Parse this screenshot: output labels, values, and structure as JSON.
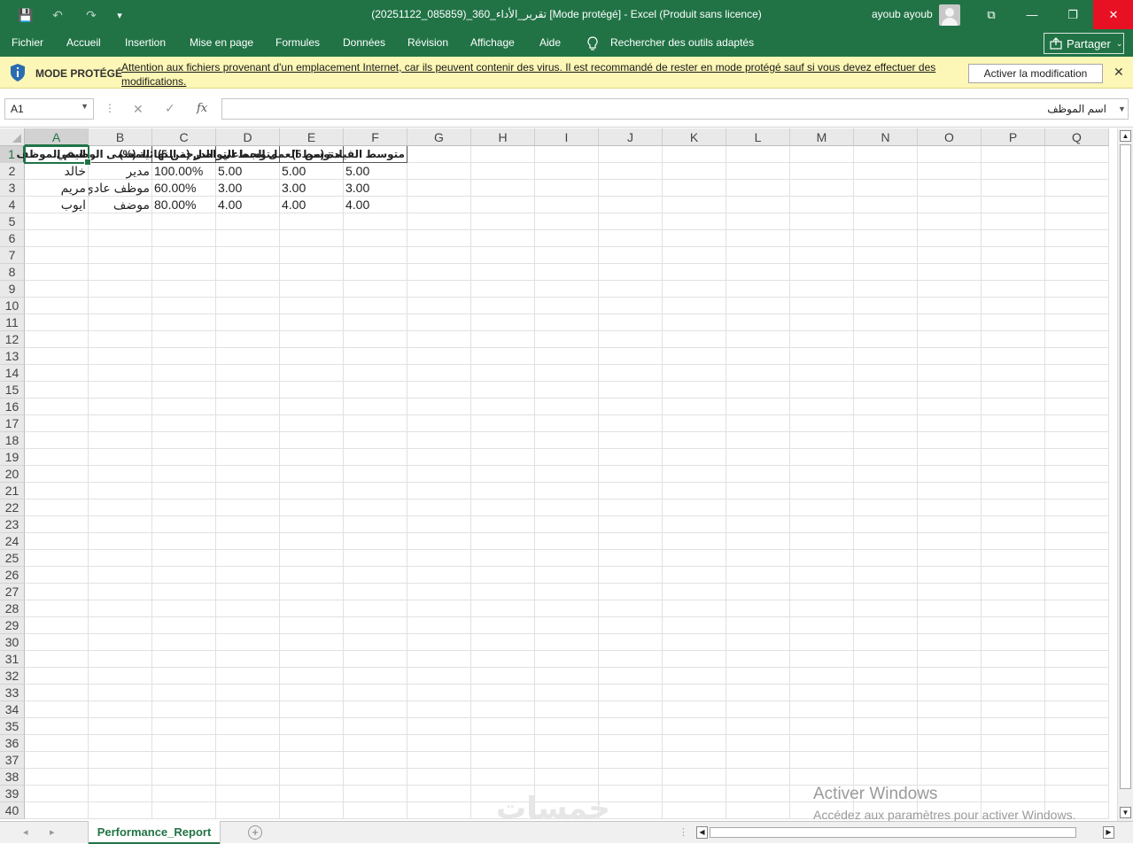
{
  "window": {
    "title": "تقرير_الأداء_360_(085859_20251122)  [Mode protégé]  -  Excel (Produit sans licence)",
    "user": "ayoub ayoub",
    "controls": {
      "ribbon_display": "⧉",
      "minimize": "—",
      "restore": "❐",
      "close": "✕"
    }
  },
  "quick_access": {
    "save": "💾",
    "undo": "↶",
    "redo": "↷",
    "customize": "▾"
  },
  "ribbon": {
    "tabs": [
      "Fichier",
      "Accueil",
      "Insertion",
      "Mise en page",
      "Formules",
      "Données",
      "Révision",
      "Affichage",
      "Aide"
    ],
    "search_label": "Rechercher des outils adaptés",
    "share_label": "Partager"
  },
  "protected_view": {
    "title": "MODE PROTÉGÉ",
    "message": "Attention aux fichiers provenant d'un emplacement Internet, car ils peuvent contenir des virus. Il est recommandé de rester en mode protégé sauf si vous devez effectuer des modifications.",
    "enable_button": "Activer la modification",
    "close": "✕"
  },
  "formula_bar": {
    "name_box": "A1",
    "cancel": "✕",
    "enter": "✓",
    "fx": "fx",
    "content": "اسم الموظف"
  },
  "columns": [
    "A",
    "B",
    "C",
    "D",
    "E",
    "F",
    "G",
    "H",
    "I",
    "J",
    "K",
    "L",
    "M",
    "N",
    "O",
    "P",
    "Q"
  ],
  "rows": [
    "1",
    "2",
    "3",
    "4",
    "5",
    "6",
    "7",
    "8",
    "9",
    "10",
    "11",
    "12",
    "13",
    "14",
    "15",
    "16",
    "17",
    "18",
    "19",
    "20",
    "21",
    "22",
    "23",
    "24",
    "25",
    "26",
    "27",
    "28",
    "29",
    "30",
    "31",
    "32",
    "33",
    "34",
    "35",
    "36",
    "37",
    "38",
    "39",
    "40"
  ],
  "sheet": {
    "headers": [
      "اسم الموظف",
      "المسمى الوظيفي",
      "الدرجة النهائية (%)",
      "متوسط التواصل (من 5)",
      "متوسط العمل الجماعي",
      "متوسط القيادة (من 5)"
    ],
    "rows": [
      [
        "خالد",
        "مدير",
        "100.00%",
        "5.00",
        "5.00",
        "5.00"
      ],
      [
        "مريم",
        "موظف عادي",
        "60.00%",
        "3.00",
        "3.00",
        "3.00"
      ],
      [
        "ايوب",
        "موضف",
        "80.00%",
        "4.00",
        "4.00",
        "4.00"
      ]
    ]
  },
  "sheet_tabs": {
    "active": "Performance_Report",
    "add": "+"
  },
  "activation_watermark": {
    "line1": "Activer Windows",
    "line2": "Accédez aux paramètres pour activer Windows."
  },
  "site_watermark": "خمسات"
}
